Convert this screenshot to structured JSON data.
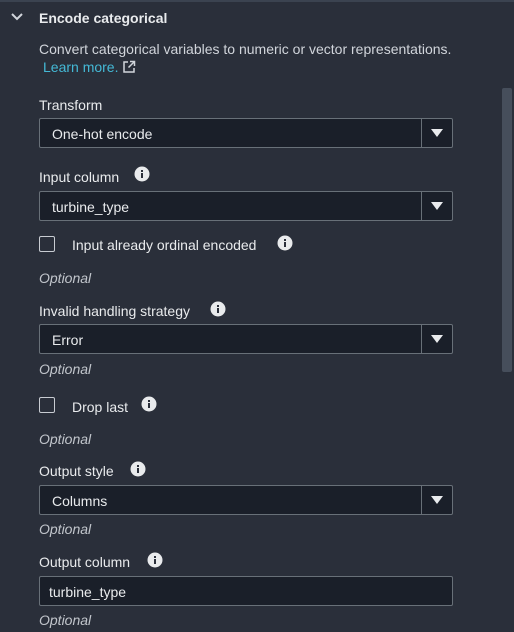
{
  "section": {
    "title": "Encode categorical",
    "description": "Convert categorical variables to numeric or vector representations.",
    "learn_more": "Learn more."
  },
  "transform": {
    "label": "Transform",
    "value": "One-hot encode"
  },
  "input_column": {
    "label": "Input column",
    "value": "turbine_type"
  },
  "ordinal_checkbox": {
    "label": "Input already ordinal encoded",
    "checked": false,
    "hint": "Optional"
  },
  "invalid_handling": {
    "label": "Invalid handling strategy",
    "value": "Error",
    "hint": "Optional"
  },
  "drop_last": {
    "label": "Drop last",
    "checked": false,
    "hint": "Optional"
  },
  "output_style": {
    "label": "Output style",
    "value": "Columns",
    "hint": "Optional"
  },
  "output_column": {
    "label": "Output column",
    "value": "turbine_type",
    "hint": "Optional"
  },
  "icons": {
    "collapse": "chevron-down-icon",
    "external": "external-link-icon",
    "info": "info-icon",
    "caret": "caret-down-icon"
  },
  "colors": {
    "background": "#2a2f3a",
    "field_background": "#1a1f29",
    "border": "#687078",
    "link": "#44b9d6",
    "text": "#e9ebed"
  }
}
